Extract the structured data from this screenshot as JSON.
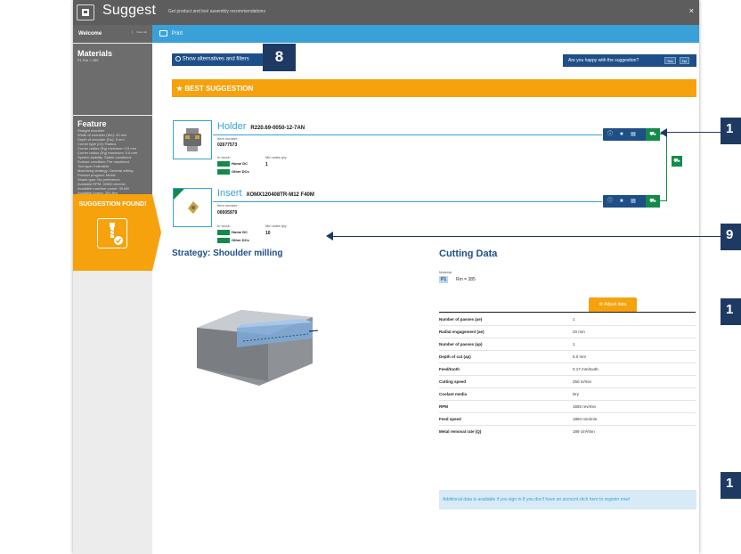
{
  "window": {
    "title": "Suggest",
    "subtitle": "Get product and tool assembly recommendations",
    "close": "×"
  },
  "sidebar": {
    "welcome": "Welcome",
    "clear_all": "Clear all",
    "materials_title": "Materials",
    "materials_value": "P1 Rm = 385",
    "feature_title": "Feature",
    "feature_lines": [
      "Straight shoulder",
      "Width of shoulder (Wo): 20 mm",
      "Depth of shoulder (Do): 5 mm",
      "Corner type (Cf): Radius",
      "Corner radius (Rg) minimum: 0.5 mm",
      "Corner radius (Rg) maximum: 0.8 mm",
      "System stability: Stable conditions",
      "Surface condition: Pre machined",
      "Tool type: Indexable",
      "Machining strategy: General milling",
      "Product program: Metric",
      "Shank type: No preference",
      "Available RPM: 30000 rev/min",
      "Available machine power: 30 kW",
      "Available torque: 200 Nm"
    ],
    "suggestion_found": "SUGGESTION FOUND!"
  },
  "toolbar": {
    "print_label": "Print"
  },
  "alternatives_button": "Show alternatives and filters",
  "callouts": {
    "c8": "8",
    "c_right_1": "1",
    "c_right_2": "9",
    "c_right_3": "1",
    "c_right_4": "1"
  },
  "happy": {
    "question": "Are you happy with the suggestion?",
    "yes": "Yes",
    "no": "No"
  },
  "best_suggestion": "★ BEST SUGGESTION",
  "holder": {
    "name": "Holder",
    "code": "R220.69-0050-12-7AN",
    "item_number_label": "Item number:",
    "item_number": "02677573",
    "in_stock_label": "In stock:",
    "min_qty_label": "Min sales qty:",
    "min_qty": "1",
    "home_dc": "Home DC",
    "other_dcs": "Other DCs"
  },
  "insert": {
    "name": "Insert",
    "code": "XOMX120408TR-M12 F40M",
    "item_number_label": "Item number:",
    "item_number": "00005979",
    "in_stock_label": "In stock:",
    "min_qty_label": "Min sales qty:",
    "min_qty": "10",
    "home_dc": "Home DC",
    "other_dcs": "Other DCs"
  },
  "strategy_title": "Strategy: Shoulder milling",
  "cutting": {
    "title": "Cutting Data",
    "material_label": "Material",
    "material_chip": "P1",
    "material_value": "Rm = 385",
    "adjust_label": "Adjust data",
    "rows": [
      {
        "k": "Number of passes (ae)",
        "v": "1"
      },
      {
        "k": "Radial engagement (ae)",
        "v": "20 mm"
      },
      {
        "k": "Number of passes (ap)",
        "v": "1"
      },
      {
        "k": "Depth of cut (ap)",
        "v": "5.0 mm"
      },
      {
        "k": "Feed/tooth",
        "v": "0.17 mm/tooth"
      },
      {
        "k": "Cutting speed",
        "v": "250 m/min"
      },
      {
        "k": "Coolant media",
        "v": "Dry"
      },
      {
        "k": "RPM",
        "v": "1592 rev/min"
      },
      {
        "k": "Feed speed",
        "v": "1894 mm/min"
      },
      {
        "k": "Metal removal rate (Q)",
        "v": "189 cm³/min"
      }
    ]
  },
  "info_text": "Additional data is available if you sign in.If you don't have an account click here to register now!",
  "colors": {
    "accent_blue": "#3aa0d8",
    "navy": "#1e4f87",
    "orange": "#f5a20d",
    "green": "#148a4a"
  }
}
